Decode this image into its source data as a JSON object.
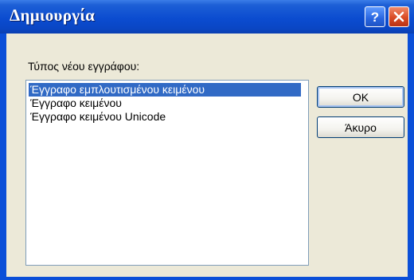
{
  "window": {
    "title": "Δημιουργία"
  },
  "titlebar_buttons": {
    "help_icon": "question-mark",
    "close_icon": "x-mark"
  },
  "dialog": {
    "label": "Τύπος νέου εγγράφου:",
    "items": [
      "Έγγραφο εμπλουτισμένου κειμένου",
      "Έγγραφο κειμένου",
      "Έγγραφο κειμένου Unicode"
    ],
    "selected_index": 0,
    "ok_label": "OK",
    "cancel_label": "Άκυρο"
  },
  "colors": {
    "titlebar": "#0b4cd0",
    "selection": "#316ac5",
    "close_button": "#d94b24",
    "face": "#ece9d8"
  }
}
